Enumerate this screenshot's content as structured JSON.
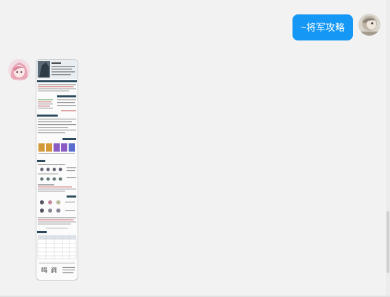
{
  "messages": {
    "outgoing": {
      "text": "~将军攻略"
    },
    "incoming": {
      "attachment_type": "image",
      "signature_text": "鸣 涧"
    }
  },
  "colors": {
    "bubble": "#1597f5",
    "background": "#f2f2f2"
  },
  "icons": {
    "self_avatar": "avatar-icon",
    "bot_avatar": "anime-avatar-icon"
  }
}
